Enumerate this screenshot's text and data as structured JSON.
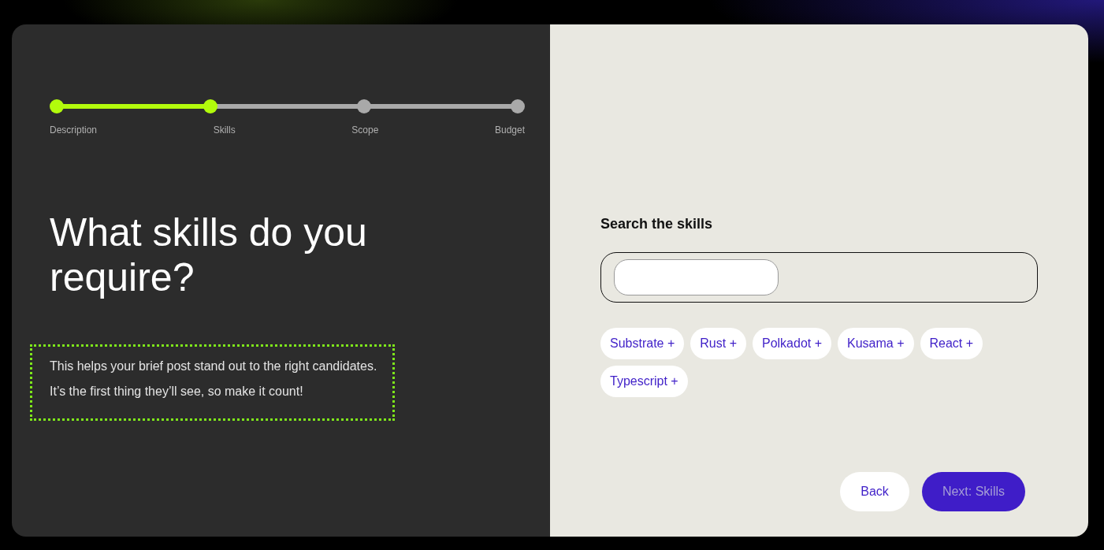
{
  "steps": [
    {
      "label": "Description",
      "done": true
    },
    {
      "label": "Skills",
      "done": true
    },
    {
      "label": "Scope",
      "done": false
    },
    {
      "label": "Budget",
      "done": false
    }
  ],
  "heading": "What skills do you require?",
  "hint": [
    "This helps your brief post stand out to the right candidates.",
    "It’s the first thing they’ll see, so make it count!"
  ],
  "search": {
    "label": "Search the skills"
  },
  "skills": [
    "Substrate +",
    "Rust +",
    "Polkadot +",
    "Kusama +",
    "React +",
    "Typescript +"
  ],
  "buttons": [
    {
      "label": "Back",
      "kind": "secondary",
      "disabled": false
    },
    {
      "label": "Next: Skills",
      "kind": "primary",
      "disabled": true
    }
  ]
}
